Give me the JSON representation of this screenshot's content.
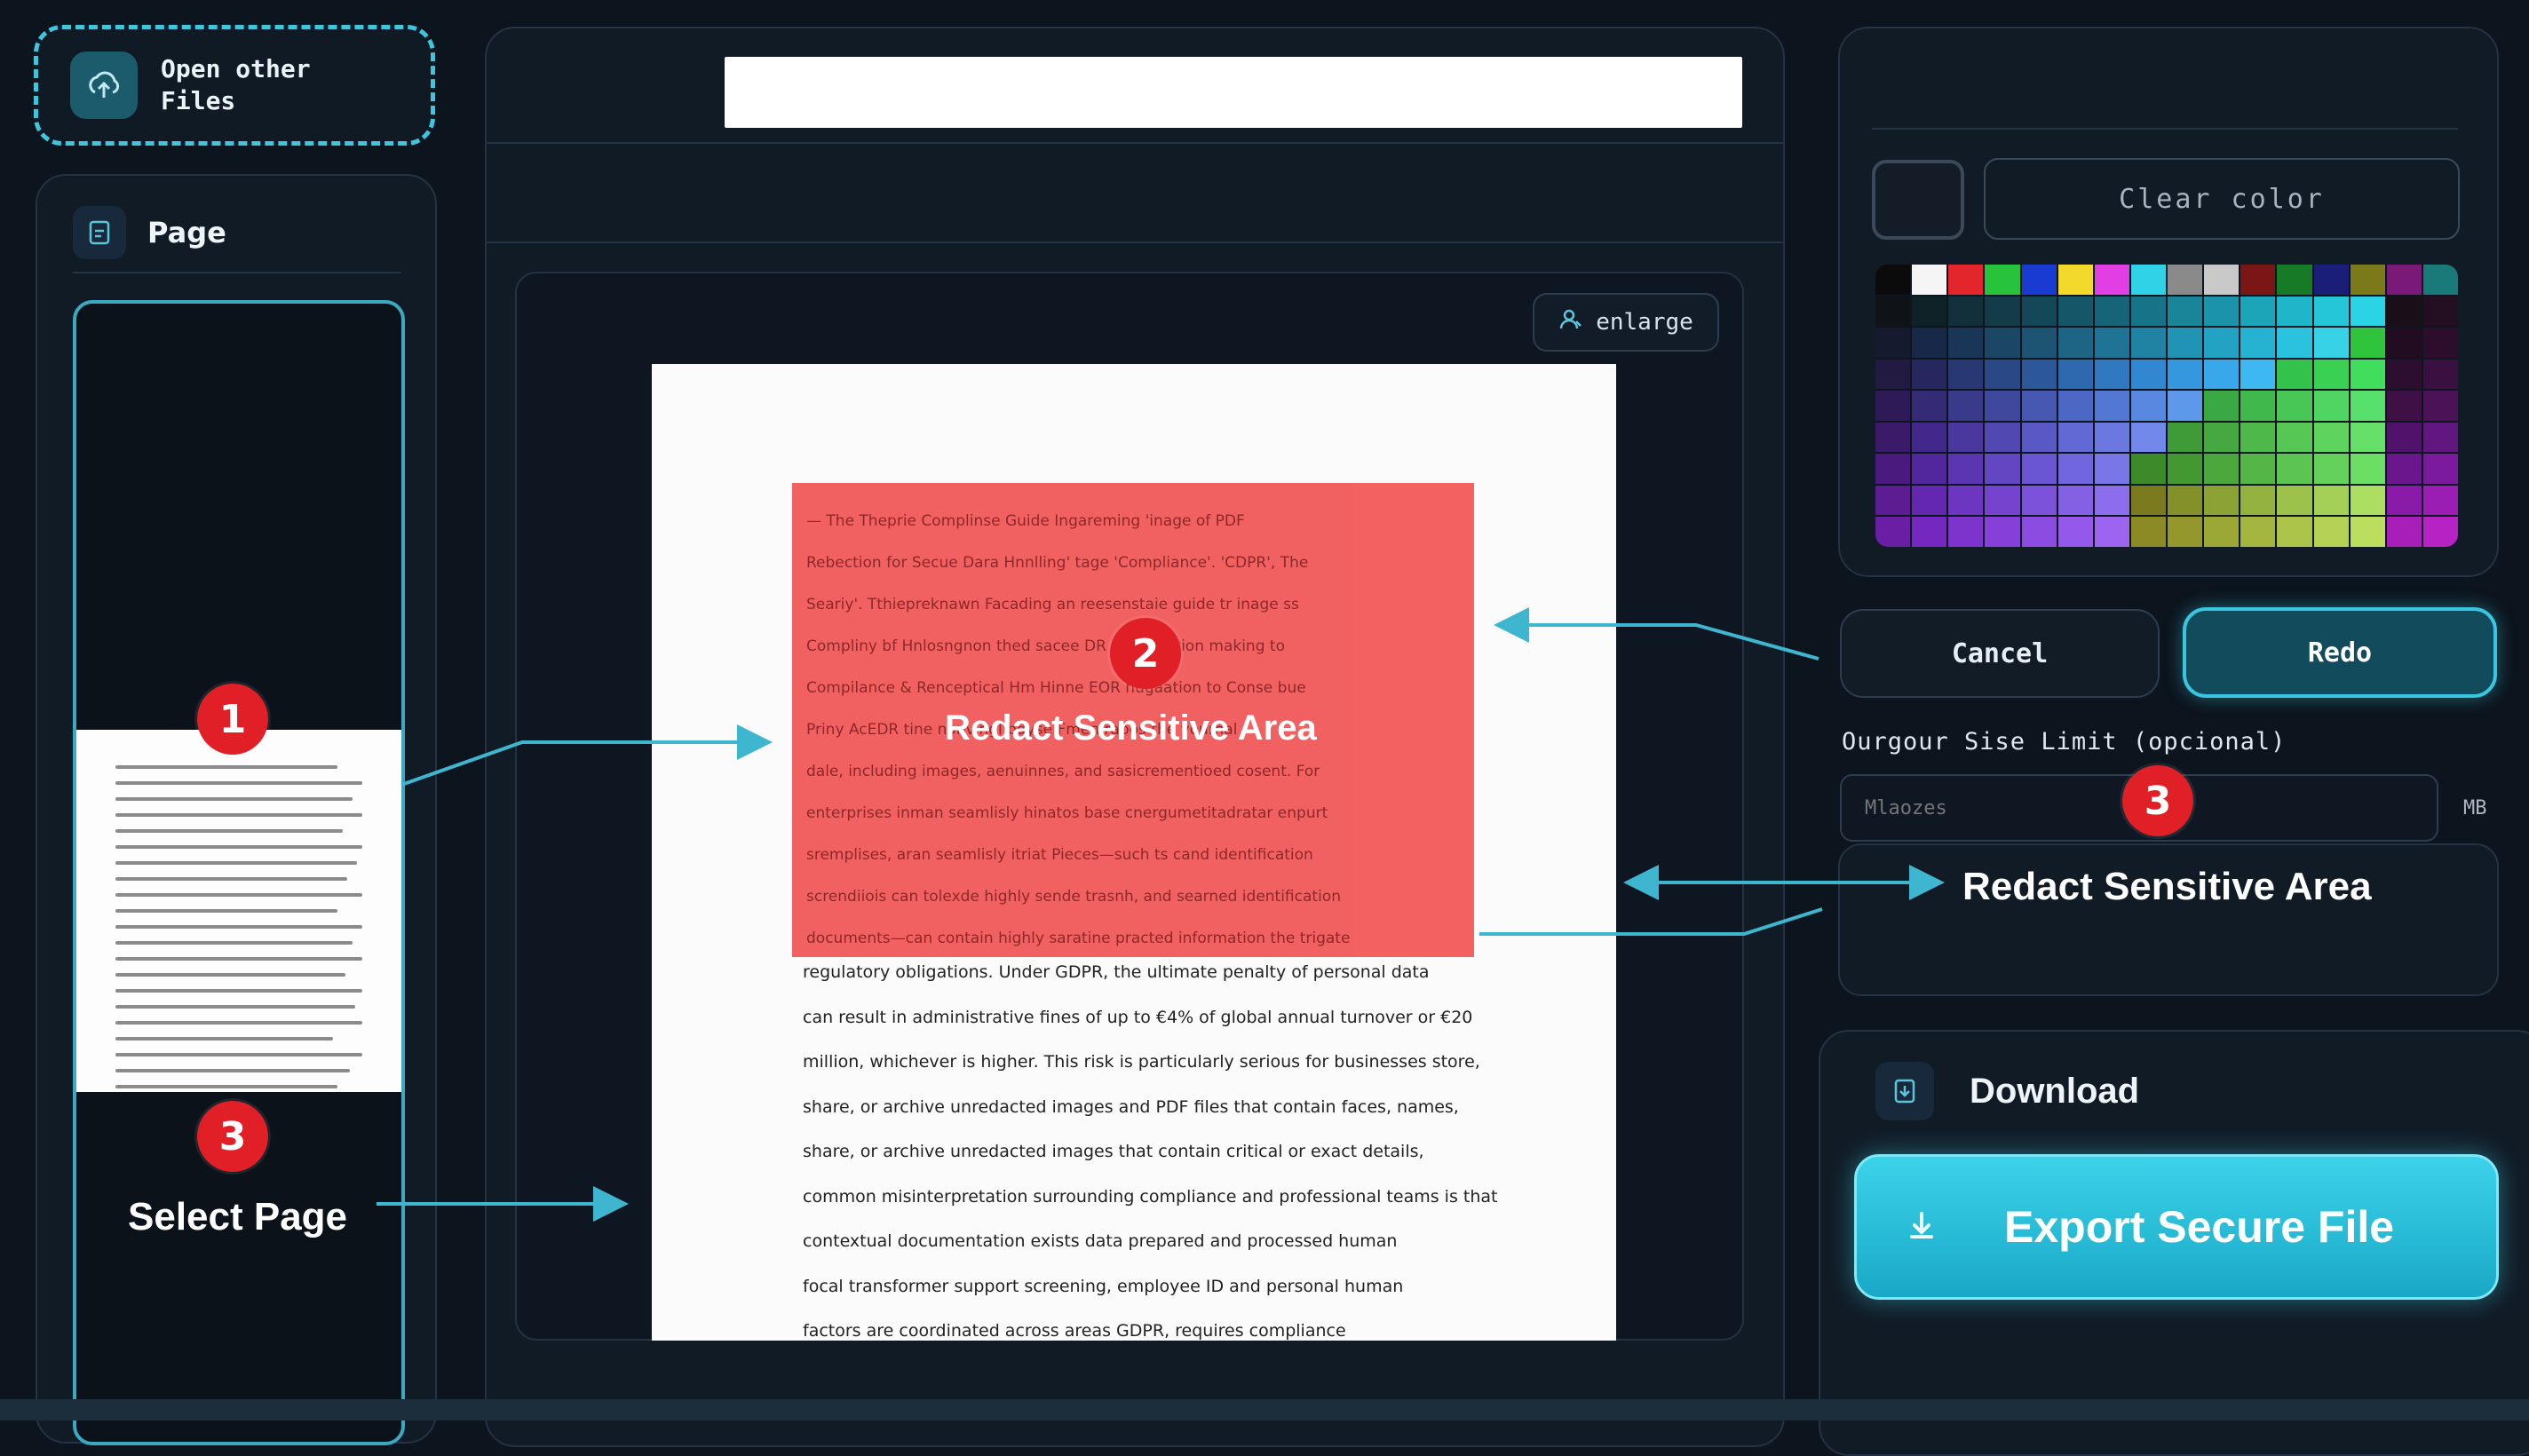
{
  "open_files": {
    "label": "Open other Files",
    "icon": "upload-cloud-icon"
  },
  "left_panel": {
    "title": "Page",
    "icon": "page-icon",
    "badge_1": "1",
    "badge_3": "3",
    "callout": "Select Page"
  },
  "center": {
    "search_value": "",
    "enlarge_label": "enlarge",
    "enlarge_icon": "person-icon",
    "badge_2": "2",
    "redact_callout": "Redact Sensitive Area",
    "redacted_lines": [
      "— The Theprie Complinse Guide Ingareming 'inage of PDF",
      "Rebection for Secue Dara Hnnlling' tage 'Compliance'. 'CDPR', The",
      "Seariy'. Tthiepreknawn Facading an reesenstaie guide tr inage ss",
      "Compliny bf Hnlosngnon thed sacee DR baseanation making to",
      "Compilance & Renceptical Hm Hinne EOR hugaation to Conse bue",
      "Priny AcEDR tine nonvingl bdyse Fmen rapos the yournal",
      "dale, including images, aenuinnes, and sasicrementioed cosent. For",
      "enterprises inman seamlisly hinatos base cnergumetitadratar enpurt",
      "sremplises, aran seamlisly itriat Pieces—such ts cand identification",
      "screndiiois can tolexde highly sende trasnh, and searned identification",
      "documents—can contain highly saratine practed information the trigate"
    ],
    "doc_lines": [
      "regulatory obligations. Under GDPR, the ultimate penalty of personal data",
      "can result in administrative fines of up to €4% of global annual turnover or €20",
      "million, whichever is higher. This risk is particularly serious for businesses store,",
      "share, or archive unredacted images and PDF files that contain faces, names,",
      "share, or archive unredacted images that contain critical or exact details,",
      "common misinterpretation surrounding compliance and professional teams is that",
      "contextual documentation exists data prepared and processed human",
      "focal transformer support screening, employee ID and personal human",
      "factors are coordinated across areas GDPR, requires compliance"
    ]
  },
  "color_panel": {
    "clear_label": "Clear color",
    "palette": [
      [
        "#0b0b0b",
        "#f5f5f5",
        "#e3262b",
        "#28c33c",
        "#1a3bd1",
        "#f2d92b",
        "#e13fe3",
        "#2fd2e6",
        "#8a8a8a",
        "#c9c9c9",
        "#7a1616",
        "#167a26",
        "#1a1e78",
        "#7a7a1a",
        "#7a1a78",
        "#1a7a7a"
      ],
      [
        "#0f1216",
        "#0f2228",
        "#123039",
        "#133b48",
        "#144858",
        "#155768",
        "#166478",
        "#177488",
        "#1a8598",
        "#1b93a8",
        "#1ca5b9",
        "#1fb6c9",
        "#25c6d8",
        "#2ad4e4",
        "#1a0f18",
        "#240f22"
      ],
      [
        "#161a2e",
        "#182848",
        "#1a3657",
        "#1c4666",
        "#1d5474",
        "#1e6484",
        "#1f7394",
        "#2083a4",
        "#2193b4",
        "#22a3c4",
        "#26b3d2",
        "#2bc2de",
        "#37d2e6",
        "#2fc43b",
        "#220c22",
        "#2c0e2c"
      ],
      [
        "#231a42",
        "#26275e",
        "#283872",
        "#2a4886",
        "#2c589a",
        "#2e68ae",
        "#3078c0",
        "#3288d0",
        "#3598de",
        "#39a8ea",
        "#3db8f0",
        "#33c24c",
        "#3ad054",
        "#41de5e",
        "#2e0e30",
        "#3a1040"
      ],
      [
        "#2e1a56",
        "#342a76",
        "#3a3a8a",
        "#40489e",
        "#4658b2",
        "#4c68c4",
        "#5278d4",
        "#5888e0",
        "#5e98ea",
        "#3aa944",
        "#41b84c",
        "#48c656",
        "#50d462",
        "#57e06c",
        "#3e1046",
        "#4c1258"
      ],
      [
        "#3c1a6a",
        "#42288a",
        "#4a389e",
        "#5248b2",
        "#5a58c4",
        "#6268d4",
        "#6a78e0",
        "#7288ea",
        "#3f9a38",
        "#46a840",
        "#4eb84a",
        "#56c654",
        "#5ed45e",
        "#66e068",
        "#50126a",
        "#621680"
      ],
      [
        "#4a1a7e",
        "#52279e",
        "#5a36b0",
        "#6246c2",
        "#6a56d2",
        "#7266de",
        "#7a76e8",
        "#3d8a2a",
        "#449832",
        "#4ca83c",
        "#54b646",
        "#5cc450",
        "#64d25a",
        "#6cde64",
        "#6a168c",
        "#7c1a9e"
      ],
      [
        "#5c1c92",
        "#6428b0",
        "#6c36c0",
        "#7444ce",
        "#7c52da",
        "#8460e4",
        "#8c6eec",
        "#7c7a1e",
        "#849028",
        "#8ca234",
        "#94b240",
        "#9cc24c",
        "#a4d058",
        "#acde62",
        "#8a1aa8",
        "#9a1eb4"
      ],
      [
        "#6a1ea4",
        "#7428c0",
        "#7c34cc",
        "#8440d8",
        "#8c4ce2",
        "#9458ea",
        "#9c64f0",
        "#8c8a24",
        "#94982c",
        "#9ca836",
        "#a4b640",
        "#acc44a",
        "#b4d254",
        "#bcde5e",
        "#a81eb8",
        "#b622c4"
      ]
    ]
  },
  "actions": {
    "cancel": "Cancel",
    "redo": "Redo"
  },
  "output": {
    "label": "Ourgour Sise Limit (opcional)",
    "placeholder": "Mlaozes",
    "unit": "MB",
    "badge_3": "3",
    "callout": "Redact Sensitive Area"
  },
  "download": {
    "title": "Download",
    "icon": "download-doc-icon",
    "export_label": "Export Secure File",
    "export_icon": "download-arrow-icon"
  },
  "colors": {
    "accent": "#3fc6dd",
    "redact": "#f25b5b",
    "badge": "#e01f26",
    "background": "#0c141d"
  }
}
